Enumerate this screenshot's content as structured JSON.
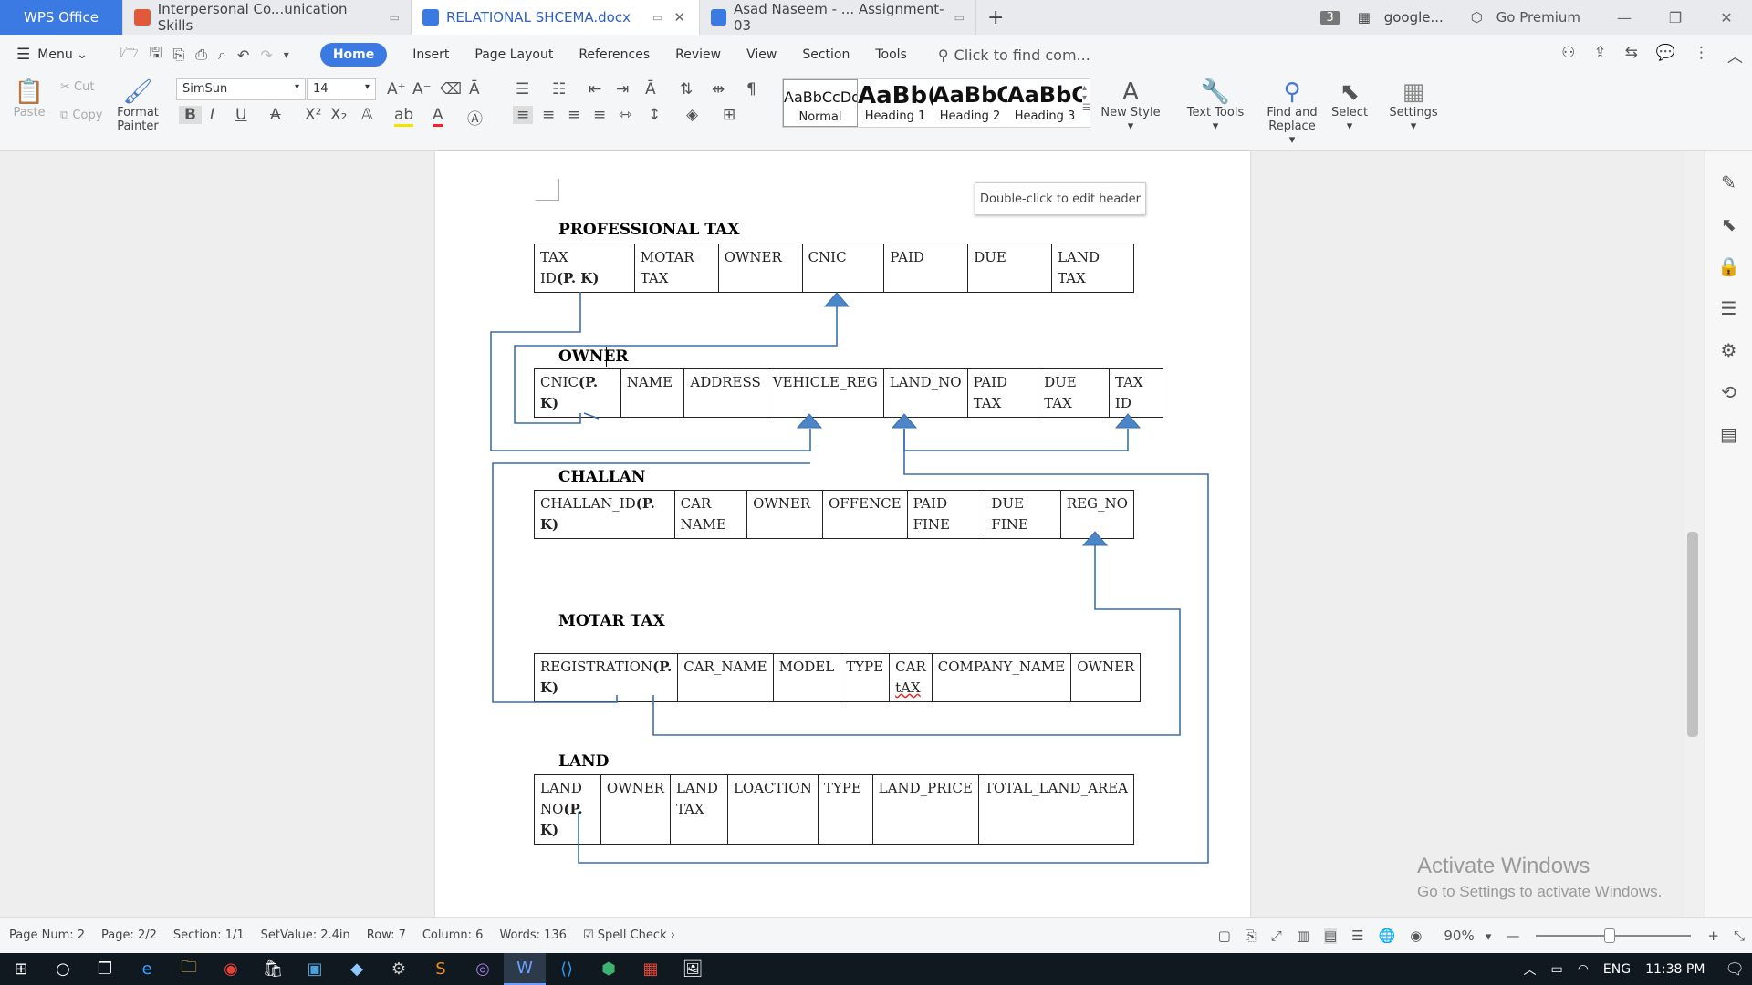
{
  "tabs": [
    {
      "label": "WPS Office"
    },
    {
      "label": "Interpersonal Co...unication Skills"
    },
    {
      "label": "RELATIONAL SHCEMA.docx"
    },
    {
      "label": "Asad Naseem - ... Assignment-03"
    }
  ],
  "tab_count_badge": "3",
  "google_tab": "google...",
  "go_premium": "Go Premium",
  "menu": {
    "menu_label": "Menu",
    "items": [
      "Home",
      "Insert",
      "Page Layout",
      "References",
      "Review",
      "View",
      "Section",
      "Tools"
    ],
    "find_placeholder": "Click to find com..."
  },
  "ribbon": {
    "paste": "Paste",
    "cut": "Cut",
    "copy": "Copy",
    "format_painter_1": "Format",
    "format_painter_2": "Painter",
    "font_name": "SimSun",
    "font_size": "14",
    "styles": [
      {
        "preview": "AaBbCcDd",
        "label": "Normal"
      },
      {
        "preview": "AaBb(",
        "label": "Heading 1"
      },
      {
        "preview": "AaBbC",
        "label": "Heading 2"
      },
      {
        "preview": "AaBbC",
        "label": "Heading 3"
      }
    ],
    "new_style": "New Style",
    "text_tools": "Text Tools",
    "find_replace_1": "Find and",
    "find_replace_2": "Replace",
    "select": "Select",
    "settings": "Settings"
  },
  "header_tip": "Double-click to edit header",
  "document": {
    "tables": [
      {
        "title": "PROFESSIONAL TAX",
        "cells": [
          [
            "TAX",
            "ID",
            "(P. K)"
          ],
          [
            "MOTAR",
            "TAX"
          ],
          [
            "OWNER"
          ],
          [
            "CNIC"
          ],
          [
            "PAID"
          ],
          [
            "DUE"
          ],
          [
            "LAND TAX"
          ]
        ]
      },
      {
        "title": "OWNER",
        "cells": [
          [
            "CNIC",
            "(P. K)"
          ],
          [
            "NAME"
          ],
          [
            "ADDRESS"
          ],
          [
            "VEHICLE_REG"
          ],
          [
            "LAND_NO"
          ],
          [
            "PAID TAX"
          ],
          [
            "DUE TAX"
          ],
          [
            "TAX",
            "ID"
          ]
        ]
      },
      {
        "title": "CHALLAN",
        "cells": [
          [
            "CHALLAN_ID",
            "(P. K)"
          ],
          [
            "CAR",
            "NAME"
          ],
          [
            "OWNER"
          ],
          [
            "OFFENCE"
          ],
          [
            "PAID",
            "FINE"
          ],
          [
            "DUE FINE"
          ],
          [
            "REG_NO"
          ]
        ]
      },
      {
        "title": "MOTAR TAX",
        "cells": [
          [
            "REGISTRATION",
            "(P. K)"
          ],
          [
            "CAR_NAME"
          ],
          [
            "MODEL"
          ],
          [
            "TYPE"
          ],
          [
            "CAR",
            "tAX"
          ],
          [
            "COMPANY_NAME"
          ],
          [
            "OWNER"
          ]
        ]
      },
      {
        "title": "LAND",
        "cells": [
          [
            "LAND",
            "NO",
            "(P. K)"
          ],
          [
            "OWNER"
          ],
          [
            "LAND",
            "TAX"
          ],
          [
            "LOACTION"
          ],
          [
            "TYPE"
          ],
          [
            "LAND_PRICE"
          ],
          [
            "TOTAL_LAND_AREA"
          ]
        ]
      }
    ]
  },
  "watermark": {
    "line1": "Activate Windows",
    "line2": "Go to Settings to activate Windows."
  },
  "status": {
    "page_num": "Page Num: 2",
    "page": "Page: 2/2",
    "section": "Section: 1/1",
    "setvalue": "SetValue: 2.4in",
    "row": "Row: 7",
    "column": "Column: 6",
    "words": "Words: 136",
    "spell_check": "Spell Check",
    "zoom": "90%"
  },
  "tray": {
    "lang": "ENG",
    "time": "11:38 PM"
  }
}
